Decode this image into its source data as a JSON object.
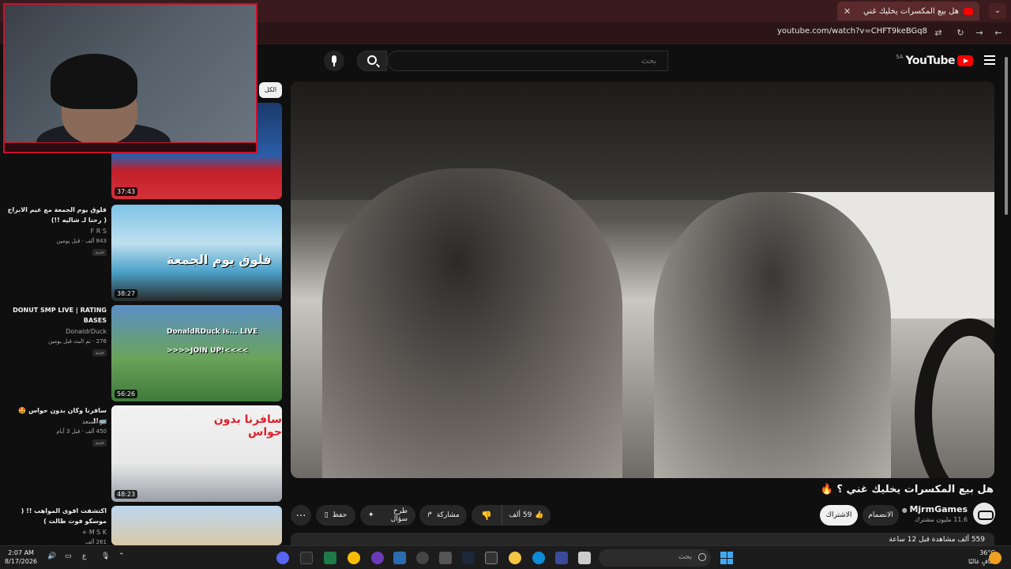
{
  "browser": {
    "tab_title": "هل بيع المكسرات يخليك غني",
    "url": "youtube.com/watch?v=CHFT9keBGq8"
  },
  "header": {
    "logo": "YouTube",
    "region": "SA",
    "search_placeholder": "بحث"
  },
  "video": {
    "title": "هل بيع المكسرات يخليك غني ؟ 🔥",
    "channel": "MjrmGames",
    "subscribers": "11.6 مليون مشترك",
    "join_label": "الانضمام",
    "subscribe_label": "الاشتراك",
    "likes": "59 ألف",
    "share_label": "مشاركة",
    "ask_label": "طرح سؤال",
    "save_label": "حفظ",
    "description_preview": "559 ألف مشاهدة قبل 12 ساعة"
  },
  "sidebar": {
    "chip": "الكل",
    "items": [
      {
        "duration": "37:43"
      },
      {
        "title": "فلوق يوم الجمعة مع عيم الابراج ( رحنا لـ شاليه !!)",
        "channel": "F R S",
        "meta": "843 ألف · قبل يومين",
        "badge": "جديد",
        "duration": "38:27",
        "thumb_text": "فلوق يوم الجمعة"
      },
      {
        "title": "DONUT SMP LIVE | RATING BASES",
        "channel": "DonaldrDuck",
        "meta": "276 · تم البث قبل يومين",
        "badge": "جديد",
        "duration": "56:26",
        "thumb_text": "DonaldRDuck Is... LIVE >>>>JOIN UP!<<<<"
      },
      {
        "title": "سافرنا وكان بدون حواس 🤩🚌!!",
        "channel": "ابو السعد",
        "meta": "450 ألف · قبل 3 أيام",
        "badge": "جديد",
        "duration": "48:23",
        "thumb_text": "سافرنا بدون حواس"
      },
      {
        "title": "اكتشفت اقوى المواهب !! ( موسكو فوت طالت )",
        "channel": "M S K +",
        "meta": "261 ألف",
        "duration": ""
      }
    ]
  },
  "taskbar": {
    "time": "2:07 AM",
    "date": "8/17/2026",
    "temperature": "36°C",
    "weather": "صافٍ غالبًا",
    "search_label": "بحث",
    "lang": "ع"
  },
  "colors": {
    "accent": "#ff0000",
    "chrome": "#3a1a1c",
    "background": "#0f0f0f"
  }
}
